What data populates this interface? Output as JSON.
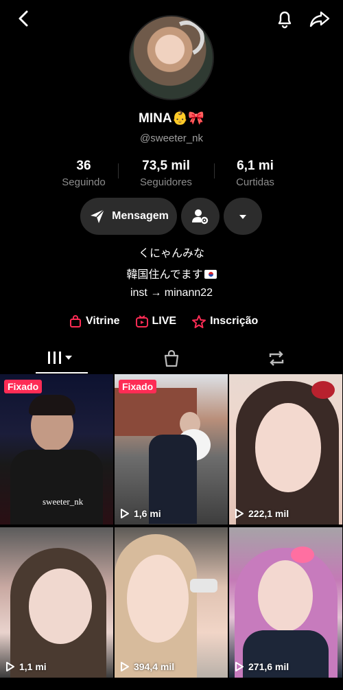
{
  "profile": {
    "display_name": "MINA",
    "name_emojis": "👶🎀",
    "handle": "@sweeter_nk"
  },
  "stats": [
    {
      "value": "36",
      "label": "Seguindo"
    },
    {
      "value": "73,5 mil",
      "label": "Seguidores"
    },
    {
      "value": "6,1 mi",
      "label": "Curtidas"
    }
  ],
  "actions": {
    "message_label": "Mensagem"
  },
  "bio": {
    "line1": "くにゃんみな",
    "line2": "韓国住んでます",
    "line3": "inst → minann22"
  },
  "links": {
    "vitrine": "Vitrine",
    "live": "LIVE",
    "inscricao": "Inscrição"
  },
  "videos": [
    {
      "pinned": "Fixado",
      "views": "",
      "watermark": "sweeter_nk"
    },
    {
      "pinned": "Fixado",
      "views": "1,6 mi"
    },
    {
      "pinned": "",
      "views": "222,1 mil"
    },
    {
      "pinned": "",
      "views": "1,1 mi"
    },
    {
      "pinned": "",
      "views": "394,4 mil"
    },
    {
      "pinned": "",
      "views": "271,6 mil"
    }
  ],
  "colors": {
    "accent": "#fe2c55",
    "button_bg": "#2c2c2c",
    "muted_text": "#8d8d8d"
  }
}
